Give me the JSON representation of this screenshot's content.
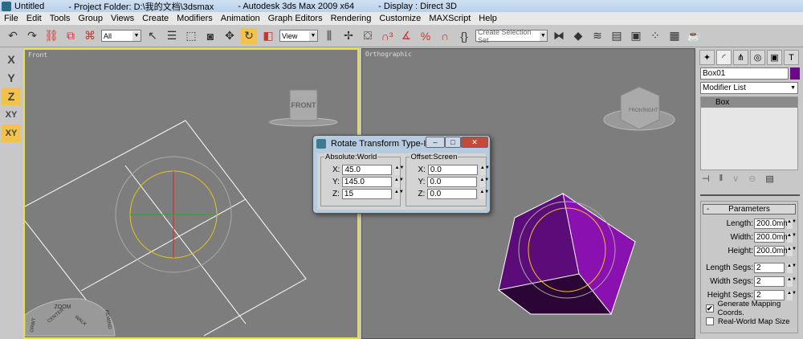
{
  "titlebar": {
    "doc": "Untitled",
    "project": "- Project Folder: D:\\我的文档\\3dsmax",
    "app": "- Autodesk 3ds Max  2009 x64",
    "display": "- Display : Direct 3D"
  },
  "menu": [
    "File",
    "Edit",
    "Tools",
    "Group",
    "Views",
    "Create",
    "Modifiers",
    "Animation",
    "Graph Editors",
    "Rendering",
    "Customize",
    "MAXScript",
    "Help"
  ],
  "toolbar": {
    "selection_filter": "All",
    "ref_coord": "View",
    "named_selection_placeholder": "Create Selection Set"
  },
  "axis_constraints": [
    "X",
    "Y",
    "Z",
    "XY",
    "XY"
  ],
  "viewports": {
    "front": {
      "label": "Front",
      "viewcube": "FRONT",
      "wheel": [
        "ZOOM",
        "CENTER",
        "WALK",
        "ORBIT",
        "REWIND"
      ]
    },
    "ortho": {
      "label": "Orthographic",
      "viewcube_faces": [
        "FRONT",
        "RIGHT"
      ]
    }
  },
  "dialog": {
    "title": "Rotate Transform Type-In",
    "absolute": {
      "label": "Absolute:World",
      "x": "45.0",
      "y": "145.0",
      "z": "15"
    },
    "offset": {
      "label": "Offset:Screen",
      "x": "0.0",
      "y": "0.0",
      "z": "0.0"
    }
  },
  "command_panel": {
    "object_name": "Box01",
    "object_color": "#6a0a8a",
    "modifier_list": "Modifier List",
    "stack": [
      "Box"
    ],
    "parameters": {
      "title": "Parameters",
      "length_label": "Length:",
      "length": "200.0mm",
      "width_label": "Width:",
      "width": "200.0mm",
      "height_label": "Height:",
      "height": "200.0mm",
      "length_segs_label": "Length Segs:",
      "length_segs": "2",
      "width_segs_label": "Width Segs:",
      "width_segs": "2",
      "height_segs_label": "Height Segs:",
      "height_segs": "2",
      "gen_mapping": "Generate Mapping Coords.",
      "gen_mapping_checked": true,
      "real_world": "Real-World Map Size",
      "real_world_checked": false
    }
  }
}
